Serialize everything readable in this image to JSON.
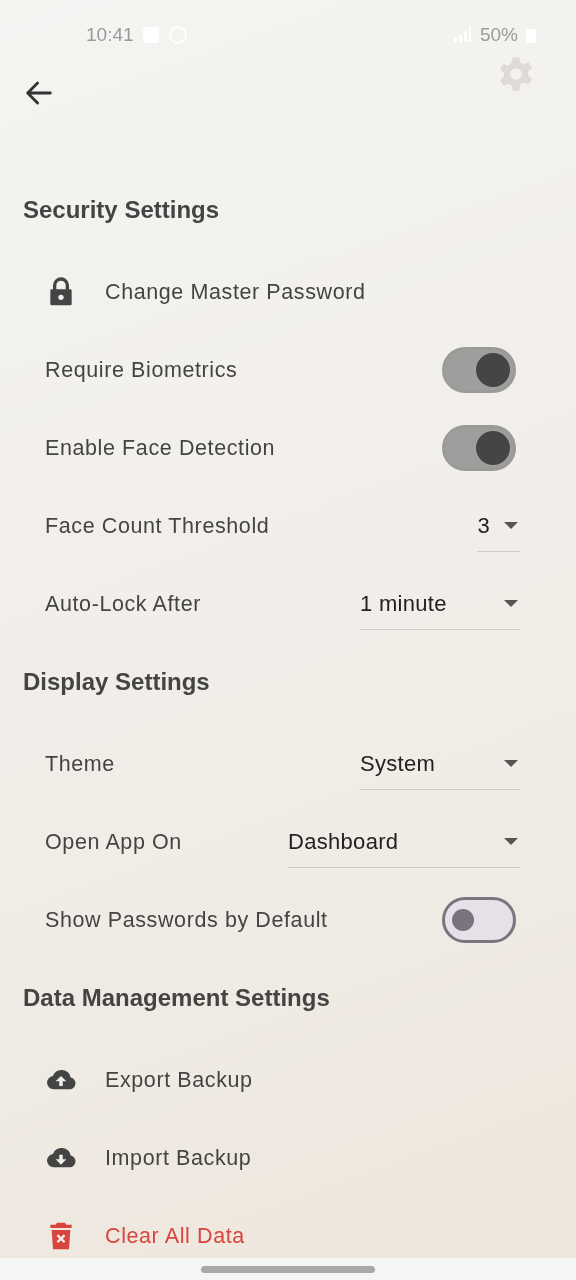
{
  "status_bar": {
    "time": "10:41",
    "battery": "50%"
  },
  "sections": [
    {
      "title": "Security Settings",
      "items": [
        {
          "kind": "action",
          "label": "Change Master Password",
          "danger": false
        },
        {
          "kind": "toggle",
          "label": "Require Biometrics",
          "on": true
        },
        {
          "kind": "toggle",
          "label": "Enable Face Detection",
          "on": true
        },
        {
          "kind": "dropdown",
          "label": "Face Count Threshold",
          "value": "3"
        },
        {
          "kind": "dropdown",
          "label": "Auto-Lock After",
          "value": "1 minute"
        }
      ]
    },
    {
      "title": "Display Settings",
      "items": [
        {
          "kind": "dropdown",
          "label": "Theme",
          "value": "System"
        },
        {
          "kind": "dropdown",
          "label": "Open App On",
          "value": "Dashboard"
        },
        {
          "kind": "toggle",
          "label": "Show Passwords by Default",
          "on": false
        }
      ]
    },
    {
      "title": "Data Management Settings",
      "items": [
        {
          "kind": "action",
          "label": "Export Backup",
          "danger": false
        },
        {
          "kind": "action",
          "label": "Import Backup",
          "danger": false
        },
        {
          "kind": "action",
          "label": "Clear All Data",
          "danger": true
        }
      ]
    }
  ]
}
